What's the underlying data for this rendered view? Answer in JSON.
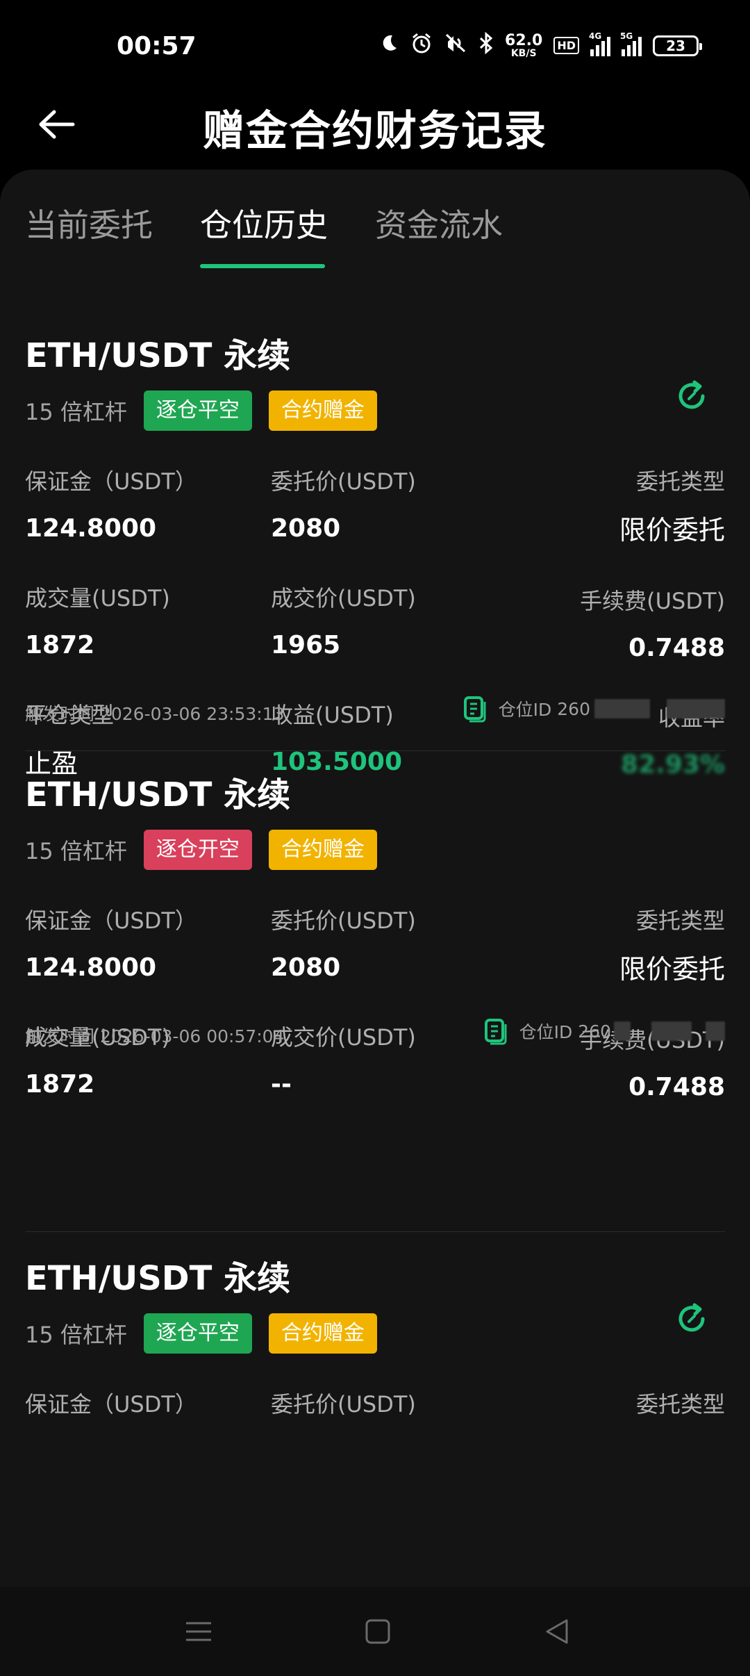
{
  "status": {
    "time": "00:57",
    "net_speed": "62.0",
    "net_unit": "KB/S",
    "hd": "HD",
    "sig1": "4G",
    "sig2": "5G",
    "battery": "23"
  },
  "header": {
    "title": "赠金合约财务记录"
  },
  "tabs": [
    {
      "label": "当前委托"
    },
    {
      "label": "仓位历史"
    },
    {
      "label": "资金流水"
    }
  ],
  "labels": {
    "margin": "保证金（USDT）",
    "order_price": "委托价(USDT)",
    "order_type": "委托类型",
    "volume": "成交量(USDT)",
    "fill_price": "成交价(USDT)",
    "fee": "手续费(USDT)",
    "close_type": "平仓类型",
    "pnl": "收益(USDT)",
    "roi": "收益率",
    "trigger_time": "触发时间",
    "position_id": "仓位ID"
  },
  "records": [
    {
      "title": "ETH/USDT 永续",
      "leverage": "15 倍杠杆",
      "side": "逐仓平空",
      "bonus_tag": "合约赠金",
      "margin": "124.8000",
      "order_price": "2080",
      "order_type": "限价委托",
      "volume": "1872",
      "fill_price": "1965",
      "fee": "0.7488",
      "close_type": "止盈",
      "pnl": "103.5000",
      "roi": "82.93%",
      "trigger_time": "2026-03-06 23:53:13",
      "position_id_prefix": "260"
    },
    {
      "title": "ETH/USDT 永续",
      "leverage": "15 倍杠杆",
      "side": "逐仓开空",
      "bonus_tag": "合约赠金",
      "margin": "124.8000",
      "order_price": "2080",
      "order_type": "限价委托",
      "volume": "1872",
      "fill_price": "--",
      "fee": "0.7488",
      "trigger_time": "2026-03-06 00:57:04",
      "position_id_prefix": "260"
    },
    {
      "title": "ETH/USDT 永续",
      "leverage": "15 倍杠杆",
      "side": "逐仓平空",
      "bonus_tag": "合约赠金"
    }
  ],
  "colors": {
    "accent": "#1fc47c",
    "tag_green": "#1fa652",
    "tag_red": "#d9405c",
    "tag_yellow": "#f2b300"
  },
  "icons": {
    "back": "arrow-left-icon",
    "refresh": "refresh-icon",
    "position": "document-icon",
    "menu": "menu-icon",
    "home": "square-icon",
    "back_nav": "triangle-back-icon"
  }
}
